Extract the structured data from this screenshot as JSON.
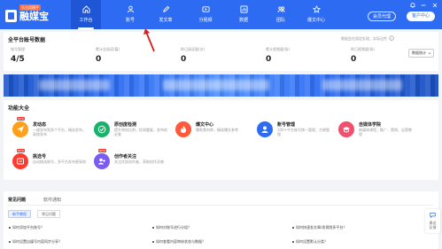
{
  "brand": {
    "tag": "乐方用随手",
    "name": "融媒宝"
  },
  "nav": [
    {
      "label": "工作台",
      "icon": "home-icon",
      "active": true
    },
    {
      "label": "账号",
      "icon": "user-icon",
      "active": false
    },
    {
      "label": "发文章",
      "icon": "pen-icon",
      "active": false
    },
    {
      "label": "分视频",
      "icon": "video-icon",
      "active": false
    },
    {
      "label": "数据",
      "icon": "chart-icon",
      "active": false
    },
    {
      "label": "团队",
      "icon": "team-icon",
      "active": false
    },
    {
      "label": "爆文中心",
      "icon": "star-icon",
      "active": false
    }
  ],
  "header_actions": {
    "member": "会员代理",
    "client": "客户中心"
  },
  "stats": {
    "title": "全平台账号数据",
    "note": "数据会在固定处理，实际达性",
    "items": [
      {
        "label": "账号管理",
        "value": "4/5"
      },
      {
        "label": "累计总阅读(篇)",
        "value": "0"
      },
      {
        "label": "昨日阅读量(次)",
        "value": "0"
      },
      {
        "label": "累计视频量(条)",
        "value": "0"
      },
      {
        "label": "昨日视频量(条)",
        "value": "0"
      }
    ],
    "dropdown": "数据统计"
  },
  "features": {
    "title": "功能大全",
    "items": [
      {
        "name": "发动态",
        "desc": "一键发布到多个平台，精选发布，高效发布",
        "color": "#ff9f1a",
        "icon": "send-icon",
        "badge": "NEW"
      },
      {
        "name": "原创度检测",
        "desc": "提升原创比例，检测重复，发布前必查",
        "color": "#19b26b",
        "icon": "check-icon",
        "badge": ""
      },
      {
        "name": "爆文中心",
        "desc": "爆款素材库，精选爆文参考",
        "color": "#ff5a3c",
        "icon": "fire-icon",
        "badge": ""
      },
      {
        "name": "账号管理",
        "desc": "100+平台账号统一管理，方便管理",
        "color": "#2d6cf2",
        "icon": "account-icon",
        "badge": ""
      },
      {
        "name": "自媒体学院",
        "desc": "新媒体课程，推广、营销、运营教程",
        "color": "#f0506e",
        "icon": "school-icon",
        "badge": ""
      },
      {
        "name": "挑选号",
        "desc": "自动挑选账号，多平台发布更高效",
        "color": "#ff3b30",
        "icon": "pick-icon",
        "badge": "NEW"
      },
      {
        "name": "创作者关注",
        "desc": "关注优质创作者，获取创作灵感",
        "color": "#7b5cf0",
        "icon": "follow-icon",
        "badge": "NEW"
      }
    ]
  },
  "faq": {
    "tabs": [
      "常见问题",
      "软件通知"
    ],
    "chips": [
      "新手教程",
      "常见问题"
    ],
    "questions": [
      "如何添加平台账号？",
      "如何对账号进行分组？",
      "如何快速发文章/发视频多平台？",
      "如何设置自媒号内容同步分享？",
      "如何查看内容审核状态与数据？",
      "如何设置默认分类？"
    ]
  },
  "feedback": {
    "line1": "建议",
    "line2": "反馈"
  }
}
